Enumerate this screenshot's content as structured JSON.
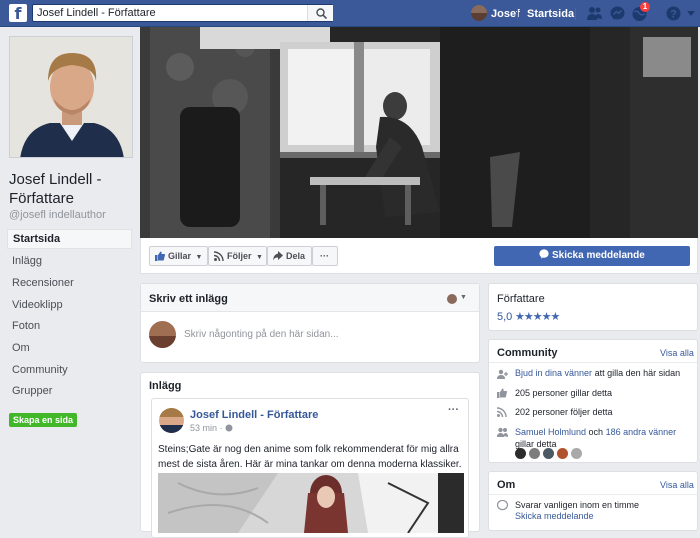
{
  "topbar": {
    "logo_letter": "f",
    "search_value": "Josef Lindell - Författare",
    "user_name": "Josef",
    "home_label": "Startsida",
    "notification_count": "1"
  },
  "profile": {
    "name": "Josef Lindell - Författare",
    "handle": "@josefl indellauthor"
  },
  "nav": {
    "items": [
      "Startsida",
      "Inlägg",
      "Recensioner",
      "Videoklipp",
      "Foton",
      "Om",
      "Community",
      "Grupper"
    ],
    "create_page": "Skapa en sida"
  },
  "actions": {
    "like": "Gillar",
    "follow": "Följer",
    "share": "Dela",
    "more": "···",
    "send_message": "Skicka meddelande"
  },
  "composer": {
    "title": "Skriv ett inlägg",
    "placeholder": "Skriv någonting på den här sidan..."
  },
  "posts": {
    "section_title": "Inlägg",
    "author": "Josef Lindell - Författare",
    "time": "53 min ·",
    "more": "···",
    "text": "Steins;Gate är nog den anime som folk rekommenderat för mig allra mest de sista åren. Här är mina tankar om denna moderna klassiker."
  },
  "rating": {
    "category": "Författare",
    "score": "5,0",
    "stars": "★★★★★",
    "value": 5.0
  },
  "community": {
    "title": "Community",
    "see_all": "Visa alla",
    "invite_link": "Bjud in dina vänner",
    "invite_rest": " att gilla den här sidan",
    "likes": "205 personer gillar detta",
    "follows": "202 personer följer detta",
    "friend_name": "Samuel Holmlund",
    "friend_and": " och ",
    "friend_others": "186 andra vänner",
    "friend_suffix": "gillar detta"
  },
  "about": {
    "title": "Om",
    "see_all": "Visa alla",
    "response": "Svarar vanligen inom en timme",
    "send_message": "Skicka meddelande"
  },
  "colors": {
    "brand": "#3b5998",
    "button_blue": "#4267b2",
    "green": "#42b72a",
    "link": "#365899",
    "star": "#4267b2"
  }
}
